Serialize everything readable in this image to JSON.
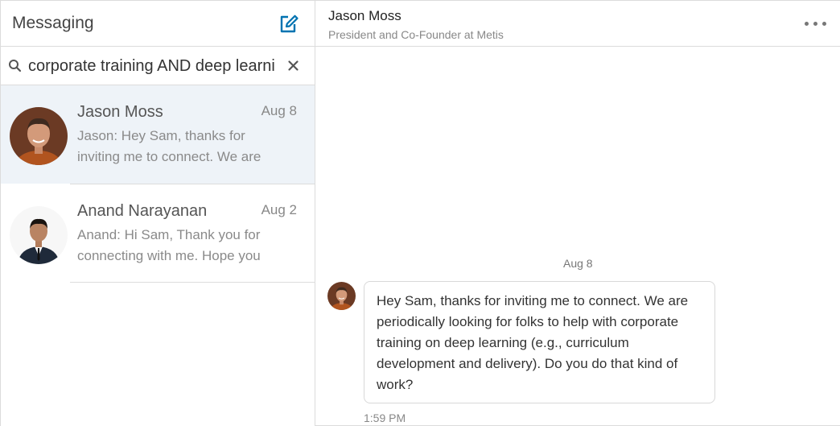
{
  "sidebar": {
    "title": "Messaging",
    "compose_icon": "compose-icon",
    "search": {
      "value": "corporate training AND deep learni",
      "placeholder": "Search messages",
      "icon": "search-icon",
      "clear_icon": "close-icon"
    },
    "conversations": [
      {
        "name": "Jason Moss",
        "date": "Aug 8",
        "preview": "Jason: Hey Sam, thanks for inviting me to connect. We are",
        "active": true
      },
      {
        "name": "Anand Narayanan",
        "date": "Aug 2",
        "preview": "Anand: Hi Sam, Thank you for connecting with me. Hope you",
        "active": false
      }
    ]
  },
  "thread": {
    "contact_name": "Jason Moss",
    "contact_headline": "President and Co-Founder at Metis",
    "more_icon": "more-options-icon",
    "date_divider": "Aug 8",
    "message": {
      "text": "Hey Sam, thanks for inviting me to connect. We are periodically looking for folks to help with corporate training on deep learning (e.g., curriculum development and delivery). Do you do that kind of work?",
      "time": "1:59 PM"
    }
  },
  "colors": {
    "accent": "#0073b1",
    "active_row": "#eef3f8",
    "border": "#dcdcdc"
  }
}
